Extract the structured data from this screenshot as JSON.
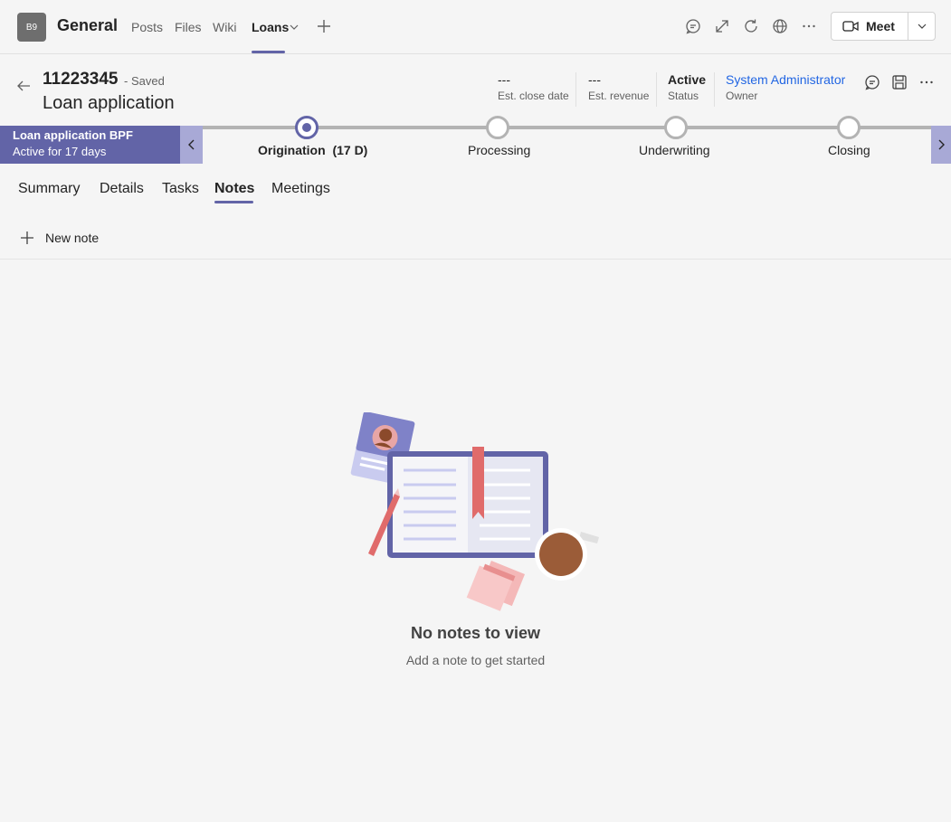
{
  "top_bar": {
    "team_avatar": "B9",
    "channel_name": "General",
    "tabs": [
      {
        "label": "Posts"
      },
      {
        "label": "Files"
      },
      {
        "label": "Wiki"
      },
      {
        "label": "Loans"
      }
    ],
    "active_tab": "Loans",
    "icons": [
      "chat-icon",
      "expand-icon",
      "refresh-icon",
      "globe-icon",
      "more-icon"
    ],
    "meet_label": "Meet"
  },
  "record": {
    "id": "11223345",
    "saved_status": "- Saved",
    "entity": "Loan application",
    "fields": [
      {
        "value": "---",
        "label": "Est. close date"
      },
      {
        "value": "---",
        "label": "Est. revenue"
      },
      {
        "value": "Active",
        "label": "Status"
      },
      {
        "value": "System Administrator",
        "label": "Owner"
      }
    ]
  },
  "bpf": {
    "name": "Loan application BPF",
    "duration": "Active for 17 days",
    "stages": [
      {
        "label": "Origination  (17 D)",
        "active": true
      },
      {
        "label": "Processing",
        "active": false
      },
      {
        "label": "Underwriting",
        "active": false
      },
      {
        "label": "Closing",
        "active": false
      }
    ]
  },
  "form_tabs": [
    {
      "label": "Summary"
    },
    {
      "label": "Details"
    },
    {
      "label": "Tasks"
    },
    {
      "label": "Notes"
    },
    {
      "label": "Meetings"
    }
  ],
  "active_form_tab": "Notes",
  "command_bar": {
    "new_note": "New note"
  },
  "empty_state": {
    "title": "No notes to view",
    "subtitle": "Add a note to get started"
  },
  "colors": {
    "accent": "#6264a7",
    "link": "#2266e3",
    "background": "#f5f5f5"
  }
}
